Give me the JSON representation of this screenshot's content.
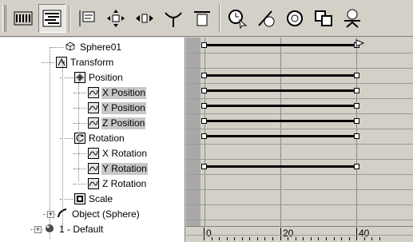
{
  "toolbar": {
    "buttons": [
      {
        "name": "edit-keys-mode",
        "icon": "dope-sheet-icon",
        "pressed": false
      },
      {
        "name": "edit-ranges-mode",
        "icon": "edit-ranges-icon",
        "pressed": true
      },
      {
        "name": "filters",
        "icon": "filters-icon",
        "pressed": false
      },
      {
        "name": "move-keys",
        "icon": "move-keys-icon",
        "pressed": false
      },
      {
        "name": "slide-keys",
        "icon": "slide-keys-icon",
        "pressed": false
      },
      {
        "name": "scale-keys",
        "icon": "scale-keys-icon",
        "pressed": false
      },
      {
        "name": "add-keys",
        "icon": "add-keys-icon",
        "pressed": false
      },
      {
        "name": "select-time",
        "icon": "select-time-icon",
        "pressed": false
      },
      {
        "name": "delete-time",
        "icon": "delete-time-icon",
        "pressed": false
      },
      {
        "name": "reverse-time",
        "icon": "reverse-time-icon",
        "pressed": false
      },
      {
        "name": "insert-time",
        "icon": "insert-time-icon",
        "pressed": false
      },
      {
        "name": "scale-time",
        "icon": "scale-time-icon",
        "pressed": false
      }
    ]
  },
  "tree": {
    "items": [
      {
        "label": "Sphere01",
        "icon": "sphere-object-icon",
        "highlight": false
      },
      {
        "label": "Transform",
        "icon": "transform-icon",
        "highlight": false
      },
      {
        "label": "Position",
        "icon": "position-icon",
        "highlight": false
      },
      {
        "label": "X Position",
        "icon": "float-curve-icon",
        "highlight": true
      },
      {
        "label": "Y Position",
        "icon": "float-curve-icon",
        "highlight": true
      },
      {
        "label": "Z Position",
        "icon": "float-curve-icon",
        "highlight": true
      },
      {
        "label": "Rotation",
        "icon": "rotation-icon",
        "highlight": false
      },
      {
        "label": "X Rotation",
        "icon": "float-curve-icon",
        "highlight": false
      },
      {
        "label": "Y Rotation",
        "icon": "float-curve-icon",
        "highlight": true
      },
      {
        "label": "Z Rotation",
        "icon": "float-curve-icon",
        "highlight": false
      },
      {
        "label": "Scale",
        "icon": "scale-icon",
        "highlight": false
      },
      {
        "label": "Object (Sphere)",
        "icon": "object-modifier-icon",
        "highlight": false
      },
      {
        "label": "1 - Default",
        "icon": "material-sphere-icon",
        "highlight": false
      }
    ]
  },
  "timeline": {
    "frame_min": 0,
    "frame_max": 46,
    "tick_labels": [
      "0",
      "20",
      "40"
    ],
    "tick_values": [
      0,
      20,
      40
    ],
    "ranges": [
      {
        "row": "Sphere01",
        "start": 0,
        "end": 40,
        "has_range": true,
        "end_selected": true
      },
      {
        "row": "Transform",
        "start": 0,
        "end": 40,
        "has_range": false
      },
      {
        "row": "Position",
        "start": 0,
        "end": 40,
        "has_range": true
      },
      {
        "row": "X Position",
        "start": 0,
        "end": 40,
        "has_range": true
      },
      {
        "row": "Y Position",
        "start": 0,
        "end": 40,
        "has_range": true
      },
      {
        "row": "Z Position",
        "start": 0,
        "end": 40,
        "has_range": true
      },
      {
        "row": "Rotation",
        "start": 0,
        "end": 40,
        "has_range": true
      },
      {
        "row": "X Rotation",
        "has_range": false
      },
      {
        "row": "Y Rotation",
        "start": 0,
        "end": 40,
        "has_range": true
      },
      {
        "row": "Z Rotation",
        "has_range": false
      },
      {
        "row": "Scale",
        "has_range": false
      },
      {
        "row": "Object (Sphere)",
        "has_range": false
      },
      {
        "row": "1 - Default",
        "has_range": false
      }
    ]
  }
}
